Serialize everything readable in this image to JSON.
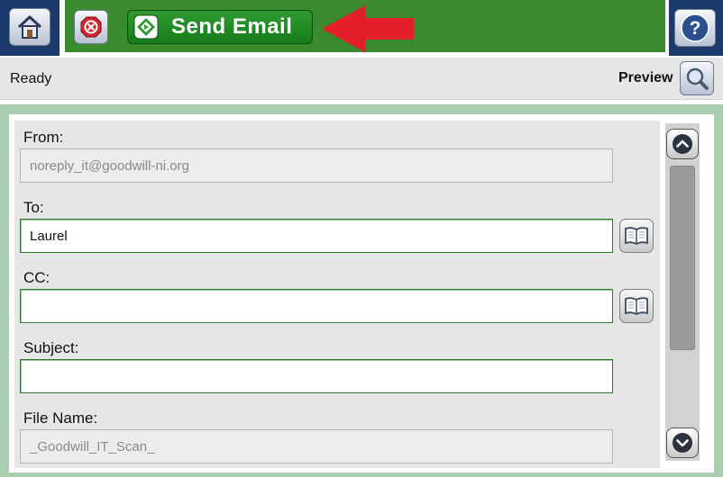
{
  "toolbar": {
    "home_icon": "home-icon",
    "stop_icon": "stop-icon",
    "send_label": "Send Email",
    "send_icon": "start-diamond-icon",
    "help_label": "?",
    "colors": {
      "toolbar_green": "#3a8a2e",
      "nav_blue": "#1b3a6b",
      "send_green": "#1f8a22",
      "arrow_red": "#e3202a"
    }
  },
  "status": {
    "text": "Ready",
    "preview_label": "Preview",
    "preview_icon": "magnifier-icon"
  },
  "form": {
    "from_label": "From:",
    "from_value": "noreply_it@goodwill-ni.org",
    "to_label": "To:",
    "to_value": "Laurel",
    "cc_label": "CC:",
    "cc_value": "",
    "subject_label": "Subject:",
    "subject_value": "",
    "filename_label": "File Name:",
    "filename_value": "_Goodwill_IT_Scan_",
    "address_book_icon": "address-book-icon"
  },
  "scrollbar": {
    "up_icon": "chevron-up-icon",
    "down_icon": "chevron-down-icon"
  }
}
